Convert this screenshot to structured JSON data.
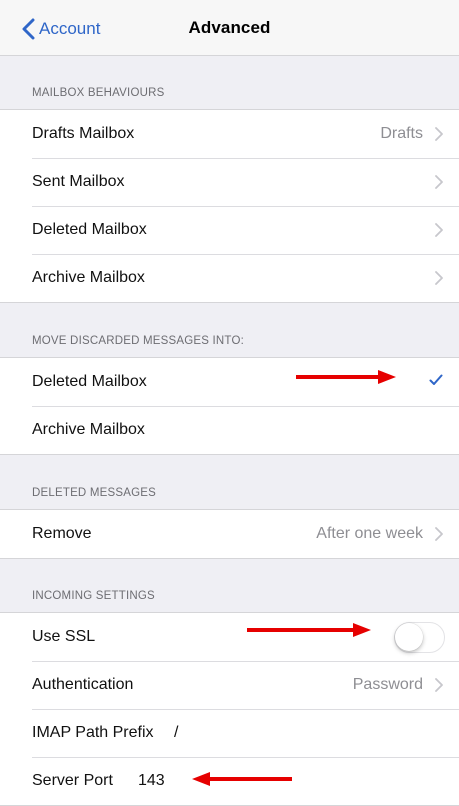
{
  "nav": {
    "back_label": "Account",
    "title": "Advanced",
    "back_icon": "chevron-left-icon"
  },
  "sections": {
    "mailbox_behaviours": {
      "header": "MAILBOX BEHAVIOURS",
      "rows": [
        {
          "label": "Drafts Mailbox",
          "value": "Drafts"
        },
        {
          "label": "Sent Mailbox",
          "value": ""
        },
        {
          "label": "Deleted Mailbox",
          "value": ""
        },
        {
          "label": "Archive Mailbox",
          "value": ""
        }
      ]
    },
    "move_discarded": {
      "header": "MOVE DISCARDED MESSAGES INTO:",
      "rows": [
        {
          "label": "Deleted Mailbox",
          "selected": true
        },
        {
          "label": "Archive Mailbox",
          "selected": false
        }
      ]
    },
    "deleted_messages": {
      "header": "DELETED MESSAGES",
      "rows": [
        {
          "label": "Remove",
          "value": "After one week"
        }
      ]
    },
    "incoming_settings": {
      "header": "INCOMING SETTINGS",
      "rows": [
        {
          "label": "Use SSL",
          "toggle_on": false
        },
        {
          "label": "Authentication",
          "value": "Password"
        },
        {
          "label": "IMAP Path Prefix",
          "value": "/"
        },
        {
          "label": "Server Port",
          "value": "143"
        }
      ]
    }
  },
  "colors": {
    "tint": "#2f66c8",
    "annotation_arrow": "#e60000",
    "background": "#efeff4"
  }
}
